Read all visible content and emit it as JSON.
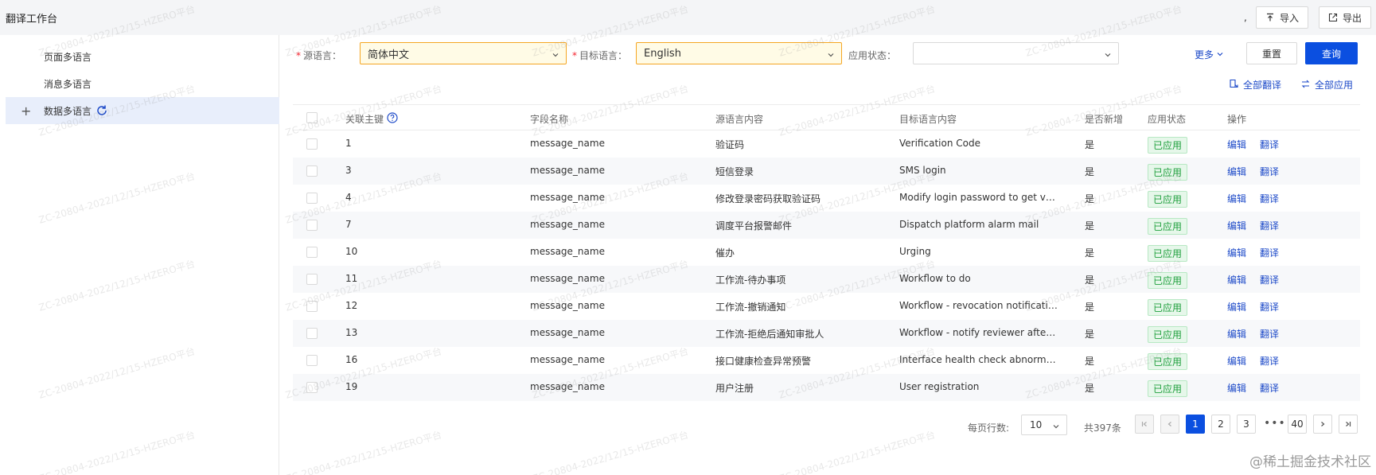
{
  "header": {
    "title": "翻译工作台",
    "comma": ",",
    "import_label": "导入",
    "export_label": "导出"
  },
  "sidebar": {
    "items": [
      {
        "label": "页面多语言"
      },
      {
        "label": "消息多语言"
      },
      {
        "label": "数据多语言",
        "active": true
      }
    ]
  },
  "filters": {
    "source_label": "源语言：",
    "source_value": "简体中文",
    "target_label": "目标语言：",
    "target_value": "English",
    "status_label": "应用状态：",
    "status_value": "",
    "required_mark": "*",
    "more_label": "更多",
    "reset_label": "重置",
    "query_label": "查询"
  },
  "toolbar": {
    "translate_all_label": "全部翻译",
    "apply_all_label": "全部应用"
  },
  "table": {
    "columns": [
      "关联主键",
      "字段名称",
      "源语言内容",
      "目标语言内容",
      "是否新增",
      "应用状态",
      "操作"
    ],
    "edit_label": "编辑",
    "translate_label": "翻译",
    "rows": [
      {
        "key": "1",
        "field": "message_name",
        "source": "验证码",
        "target": "Verification Code",
        "is_new": "是",
        "status": "已应用"
      },
      {
        "key": "3",
        "field": "message_name",
        "source": "短信登录",
        "target": "SMS login",
        "is_new": "是",
        "status": "已应用"
      },
      {
        "key": "4",
        "field": "message_name",
        "source": "修改登录密码获取验证码",
        "target": "Modify login password to get ve...",
        "is_new": "是",
        "status": "已应用"
      },
      {
        "key": "7",
        "field": "message_name",
        "source": "调度平台报警邮件",
        "target": "Dispatch platform alarm mail",
        "is_new": "是",
        "status": "已应用"
      },
      {
        "key": "10",
        "field": "message_name",
        "source": "催办",
        "target": "Urging",
        "is_new": "是",
        "status": "已应用"
      },
      {
        "key": "11",
        "field": "message_name",
        "source": "工作流-待办事项",
        "target": "Workflow to do",
        "is_new": "是",
        "status": "已应用"
      },
      {
        "key": "12",
        "field": "message_name",
        "source": "工作流-撤销通知",
        "target": "Workflow - revocation notification",
        "is_new": "是",
        "status": "已应用"
      },
      {
        "key": "13",
        "field": "message_name",
        "source": "工作流-拒绝后通知审批人",
        "target": "Workflow - notify reviewer after ...",
        "is_new": "是",
        "status": "已应用"
      },
      {
        "key": "16",
        "field": "message_name",
        "source": "接口健康检查异常预警",
        "target": "Interface health check abnormal ...",
        "is_new": "是",
        "status": "已应用"
      },
      {
        "key": "19",
        "field": "message_name",
        "source": "用户注册",
        "target": "User registration",
        "is_new": "是",
        "status": "已应用"
      }
    ]
  },
  "pagination": {
    "page_size_label": "每页行数:",
    "page_size": "10",
    "total_label": "共397条",
    "pages": [
      "1",
      "2",
      "3",
      "40"
    ],
    "current": "1",
    "ellipsis": "•••"
  },
  "watermark": "ZC-20804-2022/12/15-HZERO平台",
  "site_mark": "@稀土掘金技术社区",
  "colors": {
    "primary": "#0b4fe0",
    "link": "#1c49c8",
    "success": "#1e9f3c",
    "highlight_border": "#f5a623"
  }
}
